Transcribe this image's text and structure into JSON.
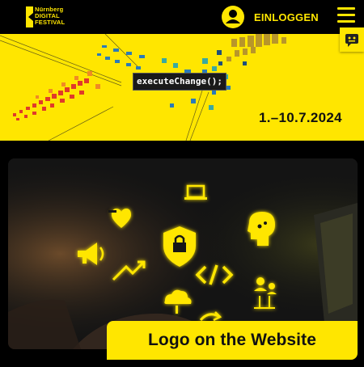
{
  "header": {
    "logo_lines": [
      "Nürnberg",
      "DIGITAL",
      "FESTIVAL"
    ],
    "login_label": "EINLOGGEN",
    "icons": {
      "user": "user-icon",
      "menu": "hamburger-menu-icon",
      "chat": "chatbot-icon"
    }
  },
  "banner": {
    "code_text": "executeChange();",
    "dates": "1.–10.7.2024"
  },
  "image_card": {
    "caption": "Logo on the Website",
    "icons": [
      "laptop-icon",
      "heart-plus-icon",
      "megaphone-icon",
      "lock-shield-icon",
      "trend-arrow-icon",
      "code-icon",
      "brain-circuit-icon",
      "cloud-icon",
      "refresh-icon",
      "network-people-icon"
    ]
  },
  "colors": {
    "accent": "#ffe600",
    "background": "#000000",
    "text_dark": "#111111"
  }
}
